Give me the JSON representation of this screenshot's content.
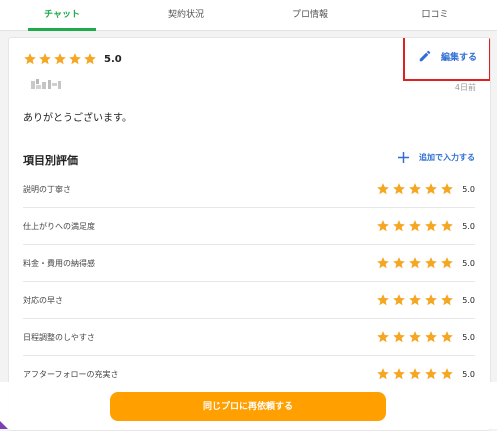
{
  "tabs": [
    {
      "label": "チャット",
      "active": true
    },
    {
      "label": "契約状況",
      "active": false
    },
    {
      "label": "プロ情報",
      "active": false
    },
    {
      "label": "口コミ",
      "active": false
    }
  ],
  "review": {
    "overall_rating": 5,
    "overall_score": "5.0",
    "edit_label": "編集する",
    "date": "4日前",
    "comment": "ありがとうございます。"
  },
  "ratings_section": {
    "title": "項目別評価",
    "add_label": "追加で入力する",
    "items": [
      {
        "label": "説明の丁寧さ",
        "rating": 5,
        "score": "5.0"
      },
      {
        "label": "仕上がりへの満足度",
        "rating": 5,
        "score": "5.0"
      },
      {
        "label": "料金・費用の納得感",
        "rating": 5,
        "score": "5.0"
      },
      {
        "label": "対応の早さ",
        "rating": 5,
        "score": "5.0"
      },
      {
        "label": "日程調整のしやすさ",
        "rating": 5,
        "score": "5.0"
      },
      {
        "label": "アフターフォローの充実さ",
        "rating": 5,
        "score": "5.0"
      }
    ]
  },
  "footer": {
    "rehire_label": "同じプロに再依頼する"
  },
  "colors": {
    "accent_green": "#1faa4b",
    "star_gold": "#f5a623",
    "link_blue": "#2f6fd4",
    "button_orange": "#ff9f00",
    "highlight_red": "#e0201f"
  },
  "icons": {
    "edit": "pencil-icon",
    "add": "plus-icon",
    "rating": "star-icon"
  }
}
